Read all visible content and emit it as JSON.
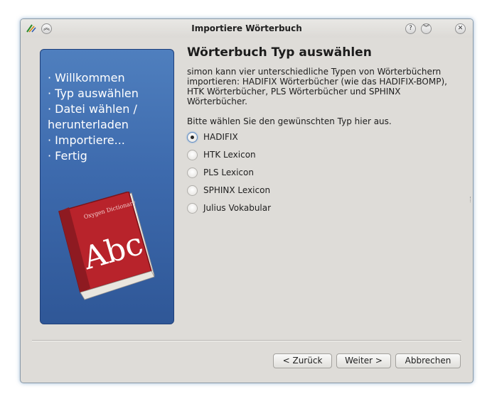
{
  "window": {
    "title": "Importiere Wörterbuch"
  },
  "titlebar_icons": [
    "app-icon",
    "keep-above-icon",
    "help-icon",
    "minimize-icon",
    "close-icon"
  ],
  "sidebar": {
    "steps": [
      "· Willkommen",
      "· Typ auswählen",
      "· Datei wählen /",
      "  herunterladen",
      "· Importiere...",
      "· Fertig"
    ],
    "book": {
      "title": "Oxygen Dictionary",
      "text": "Abc"
    }
  },
  "page": {
    "heading": "Wörterbuch Typ auswählen",
    "description": "simon kann vier unterschiedliche Typen von Wörterbüchern importieren: HADIFIX Wörterbücher (wie das HADIFIX-BOMP), HTK Wörterbücher, PLS Wörterbücher und SPHINX Wörterbücher.",
    "prompt": "Bitte wählen Sie den gewünschten Typ hier aus.",
    "options": [
      {
        "label": "HADIFIX",
        "checked": true
      },
      {
        "label": "HTK Lexicon",
        "checked": false
      },
      {
        "label": "PLS Lexicon",
        "checked": false
      },
      {
        "label": "SPHINX Lexicon",
        "checked": false
      },
      {
        "label": "Julius Vokabular",
        "checked": false
      }
    ]
  },
  "buttons": {
    "back": "< Zurück",
    "next": "Weiter >",
    "cancel": "Abbrechen"
  },
  "colors": {
    "panel": "#3d6aad",
    "book": "#b8232b",
    "window": "#dedcd8"
  }
}
